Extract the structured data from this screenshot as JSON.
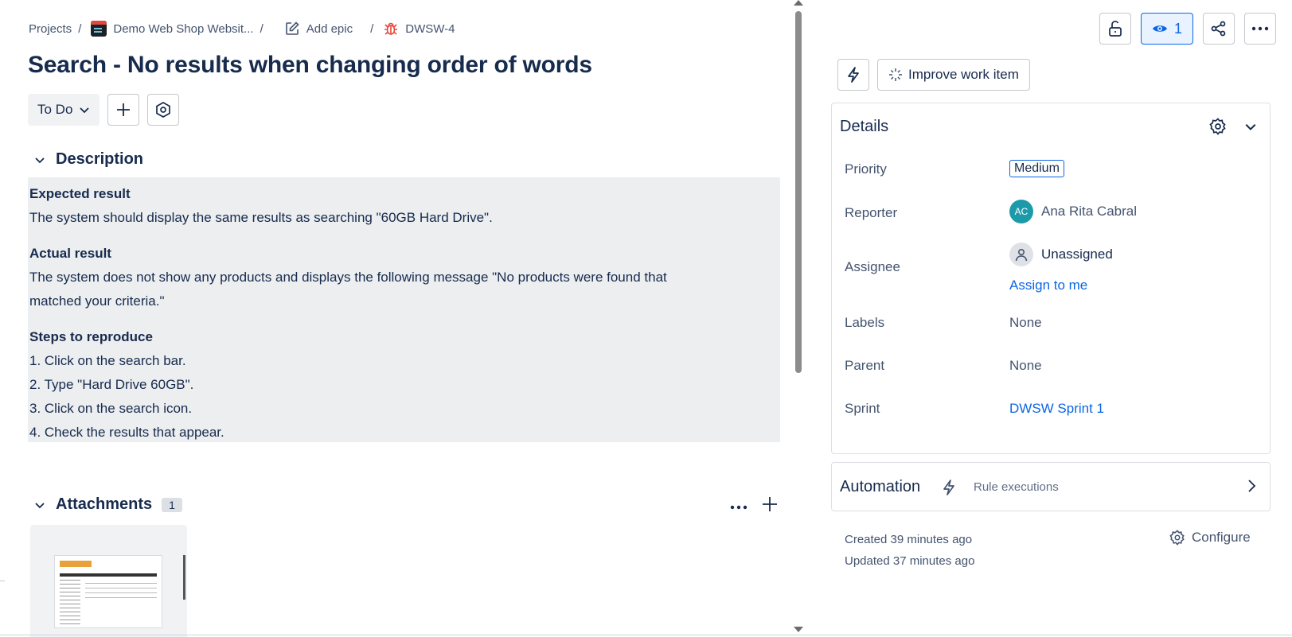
{
  "breadcrumb": {
    "projects": "Projects",
    "project": "Demo Web Shop Websit...",
    "add_epic": "Add epic",
    "issue_key": "DWSW-4"
  },
  "issue": {
    "title": "Search - No results when changing order of words",
    "status": "To Do"
  },
  "description": {
    "heading": "Description",
    "expected_heading": "Expected result",
    "expected_text": "The system should display the same results as searching \"60GB Hard Drive\".",
    "actual_heading": "Actual result",
    "actual_text_1": "The system does not show any products and displays the following message \"No products were found that",
    "actual_text_2": "matched your criteria.\"",
    "steps_heading": "Steps to reproduce",
    "steps": [
      "1. Click on the search bar.",
      "2. Type \"Hard Drive 60GB\".",
      "3. Click on the search icon.",
      "4. Check the results that appear."
    ]
  },
  "attachments": {
    "heading": "Attachments",
    "count": "1"
  },
  "top_actions": {
    "watch_count": "1"
  },
  "ai": {
    "improve_label": "Improve work item"
  },
  "details": {
    "heading": "Details",
    "priority_label": "Priority",
    "priority_value": "Medium",
    "reporter_label": "Reporter",
    "reporter_initials": "AC",
    "reporter_name": "Ana Rita Cabral",
    "assignee_label": "Assignee",
    "assignee_value": "Unassigned",
    "assign_to_me": "Assign to me",
    "labels_label": "Labels",
    "labels_value": "None",
    "parent_label": "Parent",
    "parent_value": "None",
    "sprint_label": "Sprint",
    "sprint_value": "DWSW Sprint 1"
  },
  "automation": {
    "heading": "Automation",
    "rule_executions": "Rule executions"
  },
  "meta": {
    "created": "Created 39 minutes ago",
    "updated": "Updated 37 minutes ago",
    "configure": "Configure"
  },
  "colors": {
    "accent": "#0c66e4",
    "bug": "#e2483d",
    "text": "#172b4d",
    "subtle": "#44546f"
  },
  "icons": {
    "bug": "bug-icon",
    "edit": "pencil-icon",
    "watch": "eye-icon",
    "lock": "lock-icon",
    "share": "share-icon",
    "more": "more-icon",
    "bolt": "lightning-icon",
    "sparkle": "sparkle-icon",
    "gear": "gear-icon"
  }
}
